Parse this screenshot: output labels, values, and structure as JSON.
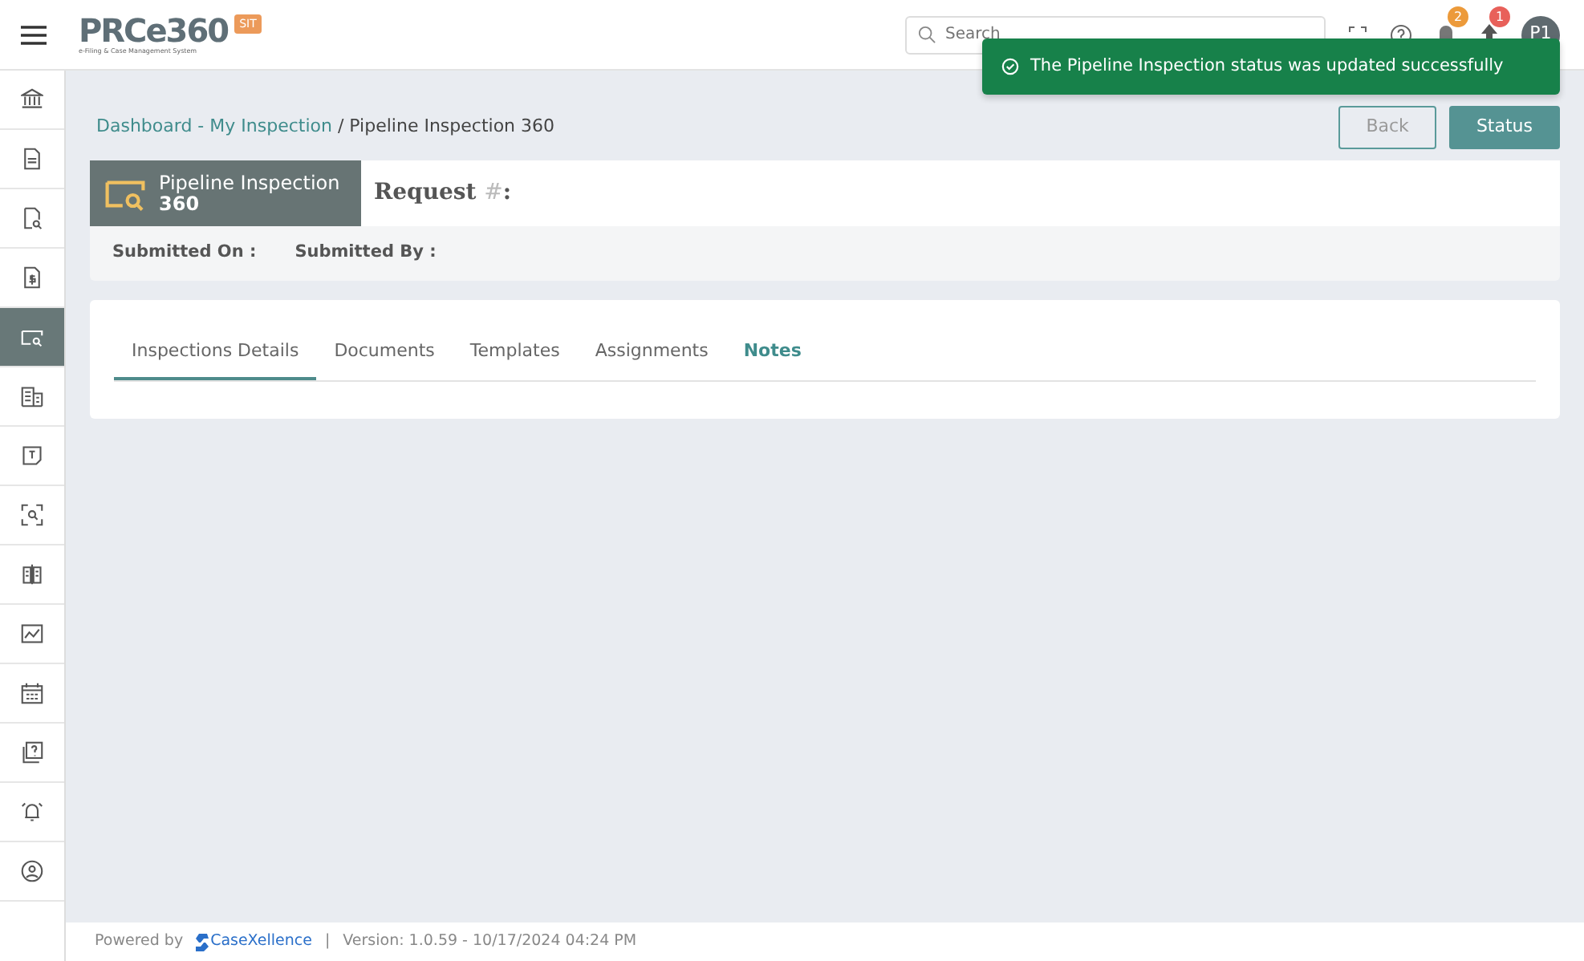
{
  "header": {
    "logo": "PRCe360",
    "logo_tagline": "e-Filing & Case Management System",
    "env_badge": "SIT",
    "search": {
      "placeholder": "Search"
    },
    "notification_count": "2",
    "alert_count": "1",
    "avatar": "P1"
  },
  "toast": {
    "message": "The Pipeline Inspection status was updated successfully"
  },
  "sidebar": {
    "items": [
      {
        "selected": false
      },
      {
        "selected": false
      },
      {
        "selected": false
      },
      {
        "selected": false
      },
      {
        "selected": true
      },
      {
        "selected": false
      },
      {
        "selected": false
      },
      {
        "selected": false
      },
      {
        "selected": false
      },
      {
        "selected": false
      },
      {
        "selected": false
      },
      {
        "selected": false
      },
      {
        "selected": false
      },
      {
        "selected": false
      }
    ]
  },
  "breadcrumb": [
    {
      "label": "Dashboard - My Inspection",
      "link": true
    },
    {
      "label": "/ Pipeline Inspection 360",
      "link": false
    }
  ],
  "buttons": [
    {
      "label": "Back",
      "kind": "outline"
    },
    {
      "label": "Status",
      "kind": "primary"
    }
  ],
  "record": {
    "type_line1": "Pipeline Inspection",
    "type_line2": "360",
    "request_label": "Request",
    "request_mark": "#",
    "request_colon": ":",
    "fields": [
      "Submitted On :",
      "Submitted By :"
    ]
  },
  "tabs": [
    {
      "label": "Inspections Details",
      "selected": true,
      "hovered": false
    },
    {
      "label": "Documents",
      "selected": false,
      "hovered": false
    },
    {
      "label": "Templates",
      "selected": false,
      "hovered": false
    },
    {
      "label": "Assignments",
      "selected": false,
      "hovered": false
    },
    {
      "label": "Notes",
      "selected": false,
      "hovered": true
    }
  ],
  "footer": {
    "powered_by": "Powered by",
    "brand": "CaseXellence",
    "separator": "|",
    "version": "Version: 1.0.59 - 10/17/2024 04:24 PM"
  }
}
